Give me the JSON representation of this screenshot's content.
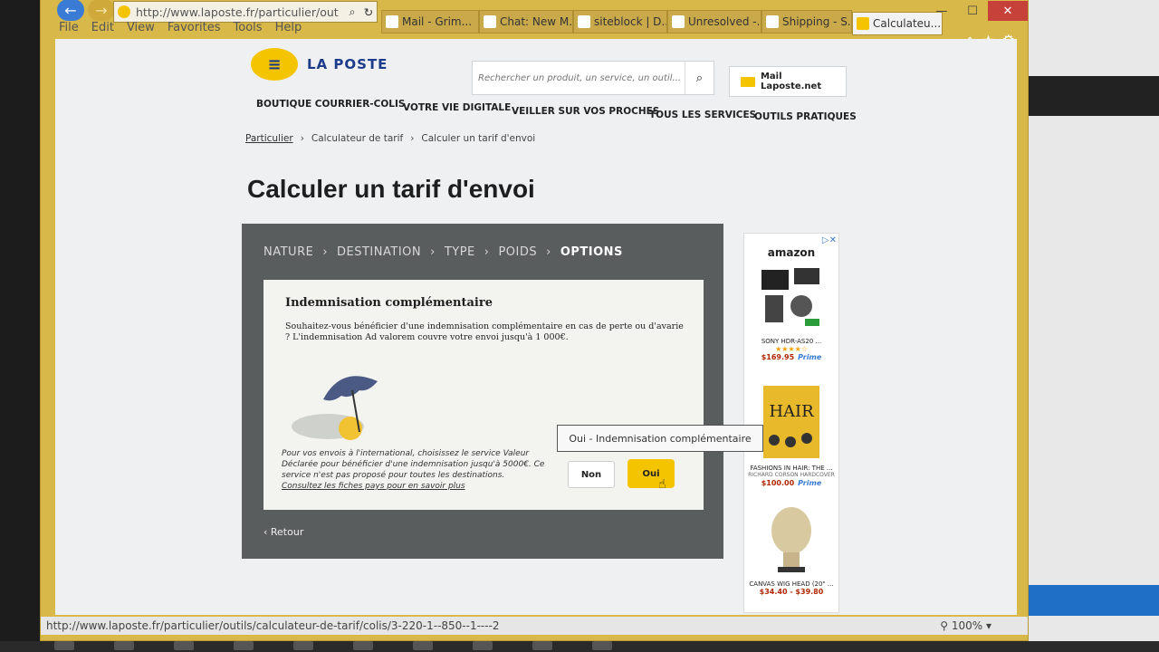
{
  "browser": {
    "url": "http://www.laposte.fr/particulier/out",
    "menu": [
      "File",
      "Edit",
      "View",
      "Favorites",
      "Tools",
      "Help"
    ],
    "tabs": [
      "Mail - Grim...",
      "Chat: New M...",
      "siteblock | D...",
      "Unresolved -...",
      "Shipping - S...",
      "Calculateu..."
    ],
    "status_url": "http://www.laposte.fr/particulier/outils/calculateur-de-tarif/colis/3-220-1--850--1----2",
    "zoom": "100%"
  },
  "site": {
    "brand": "LA POSTE",
    "search_placeholder": "Rechercher un produit, un service, un outil...",
    "mail_button": "Mail Laposte.net",
    "nav": [
      "BOUTIQUE COURRIER-COLIS",
      "VOTRE VIE DIGITALE",
      "VEILLER SUR VOS PROCHES",
      "TOUS LES SERVICES",
      "OUTILS PRATIQUES"
    ],
    "breadcrumb": [
      "Particulier",
      "Calculateur de tarif",
      "Calculer un tarif d'envoi"
    ],
    "page_title": "Calculer un tarif d'envoi"
  },
  "calculator": {
    "steps": [
      "NATURE",
      "DESTINATION",
      "TYPE",
      "POIDS",
      "OPTIONS"
    ],
    "card_title": "Indemnisation complémentaire",
    "question": "Souhaitez-vous bénéficier d'une indemnisation complémentaire en cas de perte ou d'avarie ? L'indemnisation Ad valorem couvre votre envoi jusqu'à 1 000€.",
    "info": "Pour vos envois à l'international, choisissez le service Valeur Déclarée pour bénéficier d'une indemnisation jusqu'à 5000€. Ce service n'est pas proposé pour toutes les destinations.",
    "info_link": "Consultez les fiches pays pour en savoir plus",
    "tooltip": "Oui - Indemnisation complémentaire",
    "btn_non": "Non",
    "btn_oui": "Oui",
    "back": "‹ Retour"
  },
  "ad": {
    "brand": "amazon",
    "products": [
      {
        "name": "SONY HDR-AS20 ...",
        "stars": "★★★★☆",
        "price": "$169.95",
        "prime": "Prime"
      },
      {
        "name": "FASHIONS IN HAIR: THE ...",
        "sub": "RICHARD CORSON HARDCOVER",
        "price": "$100.00",
        "prime": "Prime"
      },
      {
        "name": "CANVAS WIG HEAD (20\" ...",
        "price": "$34.40 - $39.80"
      }
    ]
  }
}
